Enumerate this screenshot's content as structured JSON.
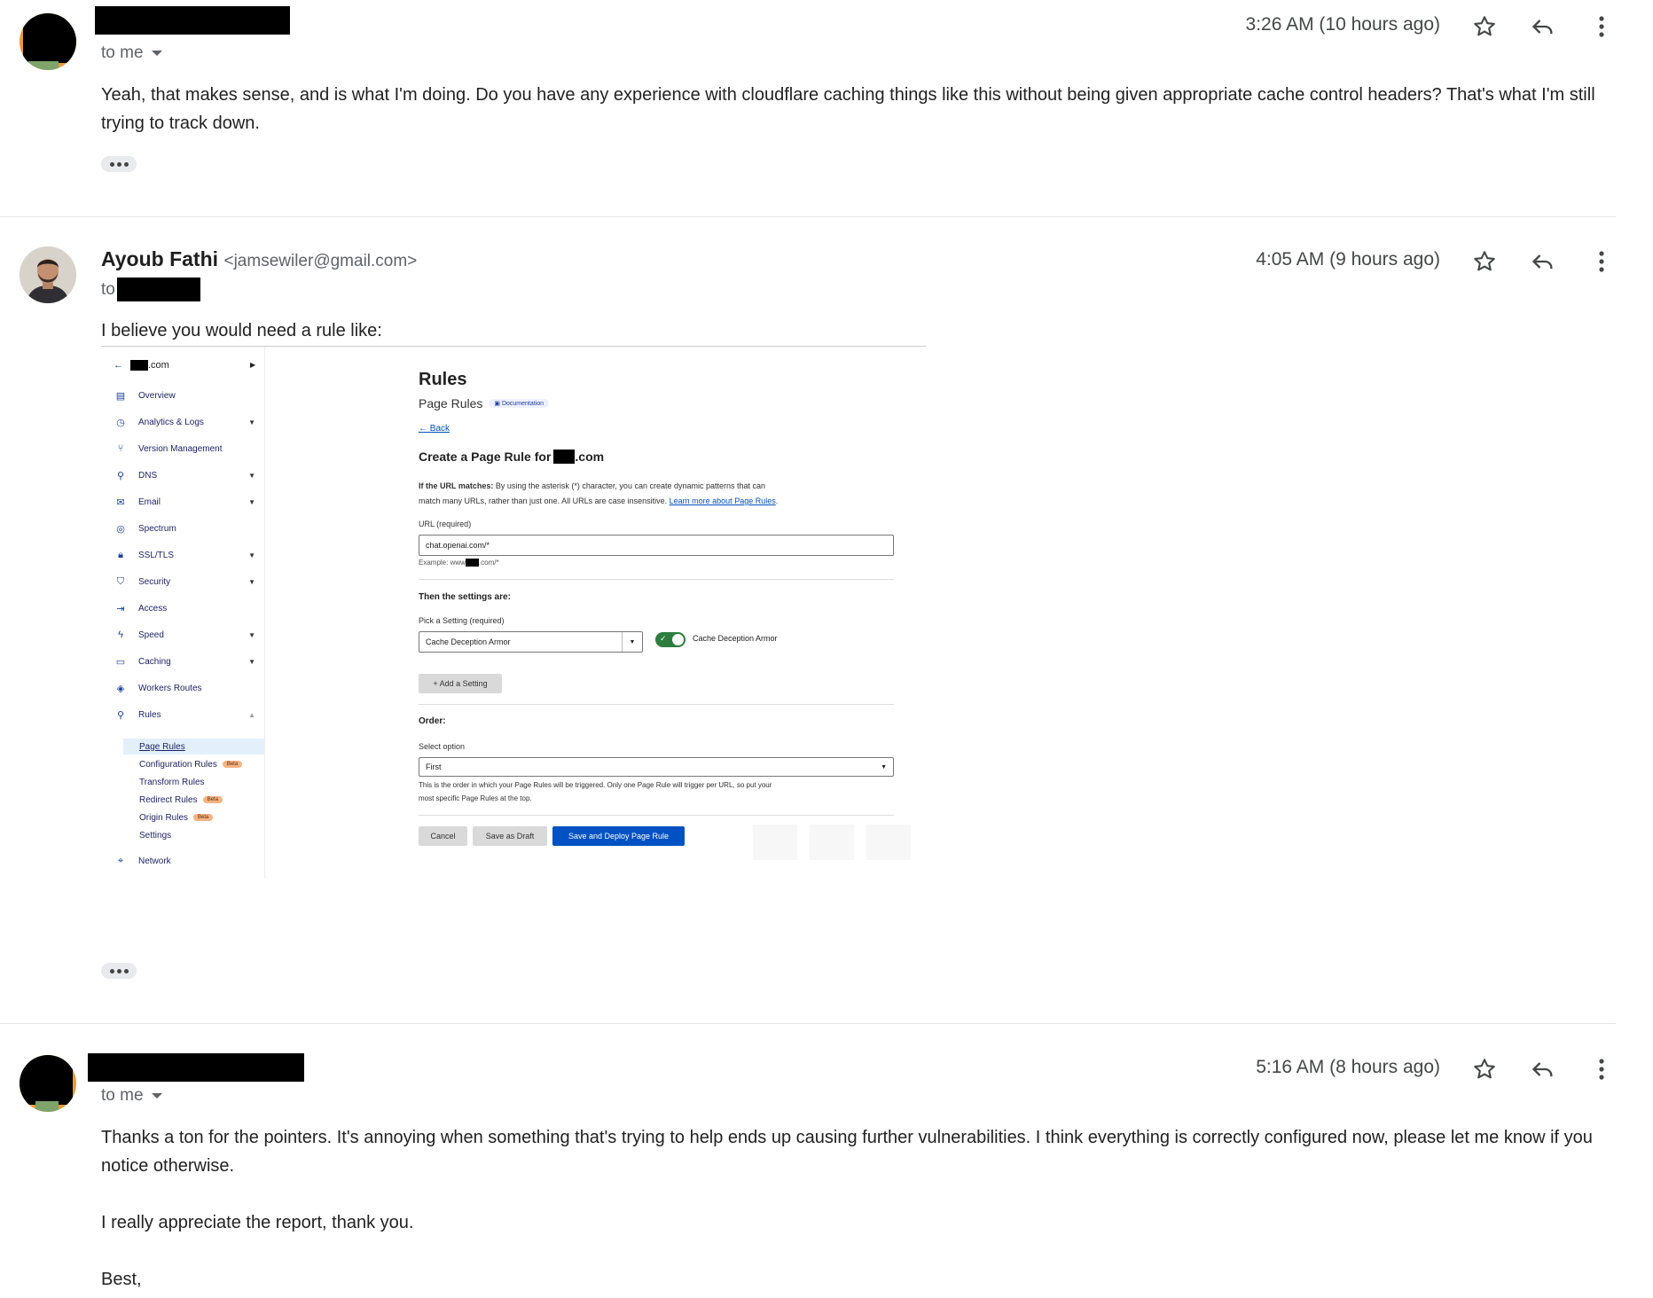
{
  "messages": [
    {
      "time": "3:26 AM (10 hours ago)",
      "recipient_label": "to me",
      "paragraphs": [
        "Yeah, that makes sense, and is what I'm doing. Do you have any experience with cloudflare caching things like this without being given appropriate cache control headers? That's what I'm still trying to track down."
      ]
    },
    {
      "sender_name": "Ayoub Fathi",
      "sender_email": "<jamsewiler@gmail.com>",
      "time": "4:05 AM (9 hours ago)",
      "recipient_label": "to",
      "intro": "I believe you would need a rule like:"
    },
    {
      "time": "5:16 AM (8 hours ago)",
      "recipient_label": "to me",
      "paragraphs": [
        "Thanks a ton for the pointers. It's annoying when something that's trying to help ends up causing further vulnerabilities. I think everything is correctly configured now, please let me know if you notice otherwise.",
        "I really appreciate the report, thank you.",
        "Best,"
      ]
    }
  ],
  "embedded_screenshot": {
    "domain_suffix": ".com",
    "sidebar": {
      "items": [
        {
          "label": "Overview",
          "icon": "document-icon"
        },
        {
          "label": "Analytics & Logs",
          "icon": "clock-icon",
          "expandable": true
        },
        {
          "label": "Version Management",
          "icon": "branch-icon"
        },
        {
          "label": "DNS",
          "icon": "network-icon",
          "expandable": true
        },
        {
          "label": "Email",
          "icon": "envelope-icon",
          "expandable": true
        },
        {
          "label": "Spectrum",
          "icon": "target-icon"
        },
        {
          "label": "SSL/TLS",
          "icon": "lock-icon",
          "expandable": true
        },
        {
          "label": "Security",
          "icon": "shield-icon",
          "expandable": true
        },
        {
          "label": "Access",
          "icon": "access-icon"
        },
        {
          "label": "Speed",
          "icon": "bolt-icon",
          "expandable": true
        },
        {
          "label": "Caching",
          "icon": "storage-icon",
          "expandable": true
        },
        {
          "label": "Workers Routes",
          "icon": "workers-icon"
        },
        {
          "label": "Rules",
          "icon": "rules-icon",
          "expanded": true
        }
      ],
      "subitems": [
        {
          "label": "Page Rules",
          "active": true
        },
        {
          "label": "Configuration Rules",
          "badge": "Beta"
        },
        {
          "label": "Transform Rules"
        },
        {
          "label": "Redirect Rules",
          "badge": "Beta"
        },
        {
          "label": "Origin Rules",
          "badge": "Beta"
        },
        {
          "label": "Settings"
        }
      ],
      "network_label": "Network"
    },
    "heading": "Rules",
    "subheading": "Page Rules",
    "doc_badge": "Documentation",
    "back_link": "Back",
    "form_title_prefix": "Create a Page Rule for",
    "form_title_suffix": ".com",
    "url_help_bold": "If the URL matches:",
    "url_help_line1": "By using the asterisk (*) character, you can create dynamic patterns that can",
    "url_help_line2": "match many URLs, rather than just one. All URLs are case insensitive.",
    "url_help_link": "Learn more about Page Rules",
    "url_label": "URL (required)",
    "url_value": "chat.openai.com/*",
    "example_prefix": "Example: www",
    "example_suffix": ".com/*",
    "settings_heading": "Then the settings are:",
    "pick_label": "Pick a Setting (required)",
    "setting_value": "Cache Deception Armor",
    "toggle_label": "Cache Deception Armor",
    "add_setting": "+ Add a Setting",
    "order_heading": "Order:",
    "select_label": "Select option",
    "order_value": "First",
    "order_help_line1": "This is the order in which your Page Rules will be triggered. Only one Page Rule will trigger per URL, so put your",
    "order_help_line2": "most specific Page Rules at the top.",
    "cancel": "Cancel",
    "save_draft": "Save as Draft",
    "save_deploy": "Save and Deploy Page Rule",
    "colors": {
      "accent": "#0051c3",
      "toggle": "#2c7d3e",
      "beta": "#f6b383"
    }
  }
}
